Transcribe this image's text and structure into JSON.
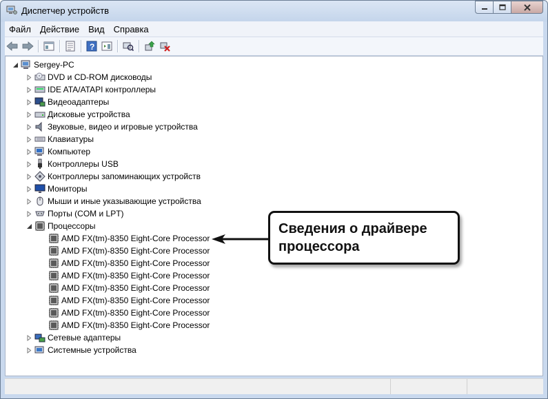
{
  "window": {
    "title": "Диспетчер устройств"
  },
  "menu": [
    "Файл",
    "Действие",
    "Вид",
    "Справка"
  ],
  "toolbar": {
    "icons": [
      "back-arrow-icon",
      "forward-arrow-icon",
      "console-tree-icon",
      "properties-icon",
      "help-icon",
      "action-pane-icon",
      "scan-hardware-icon",
      "update-driver-icon",
      "uninstall-icon"
    ]
  },
  "tree": {
    "root": "Sergey-PC",
    "categories": [
      {
        "label": "DVD и CD-ROM дисководы",
        "icon": "dvd-drive-icon"
      },
      {
        "label": "IDE ATA/ATAPI контроллеры",
        "icon": "ide-controller-icon"
      },
      {
        "label": "Видеоадаптеры",
        "icon": "display-adapter-icon"
      },
      {
        "label": "Дисковые устройства",
        "icon": "disk-drive-icon"
      },
      {
        "label": "Звуковые, видео и игровые устройства",
        "icon": "speaker-icon"
      },
      {
        "label": "Клавиатуры",
        "icon": "keyboard-icon"
      },
      {
        "label": "Компьютер",
        "icon": "computer-icon"
      },
      {
        "label": "Контроллеры USB",
        "icon": "usb-icon"
      },
      {
        "label": "Контроллеры запоминающих устройств",
        "icon": "storage-controller-icon"
      },
      {
        "label": "Мониторы",
        "icon": "monitor-icon"
      },
      {
        "label": "Мыши и иные указывающие устройства",
        "icon": "mouse-icon"
      },
      {
        "label": "Порты (COM и LPT)",
        "icon": "port-icon"
      },
      {
        "label": "Процессоры",
        "icon": "processor-icon",
        "expanded": true
      }
    ],
    "processors": [
      "AMD FX(tm)-8350 Eight-Core Processor",
      "AMD FX(tm)-8350 Eight-Core Processor",
      "AMD FX(tm)-8350 Eight-Core Processor",
      "AMD FX(tm)-8350 Eight-Core Processor",
      "AMD FX(tm)-8350 Eight-Core Processor",
      "AMD FX(tm)-8350 Eight-Core Processor",
      "AMD FX(tm)-8350 Eight-Core Processor",
      "AMD FX(tm)-8350 Eight-Core Processor"
    ],
    "after": [
      {
        "label": "Сетевые адаптеры",
        "icon": "network-adapter-icon"
      },
      {
        "label": "Системные устройства",
        "icon": "system-device-icon"
      }
    ]
  },
  "callout": {
    "line1": "Сведения о драйвере",
    "line2": "процессора"
  }
}
